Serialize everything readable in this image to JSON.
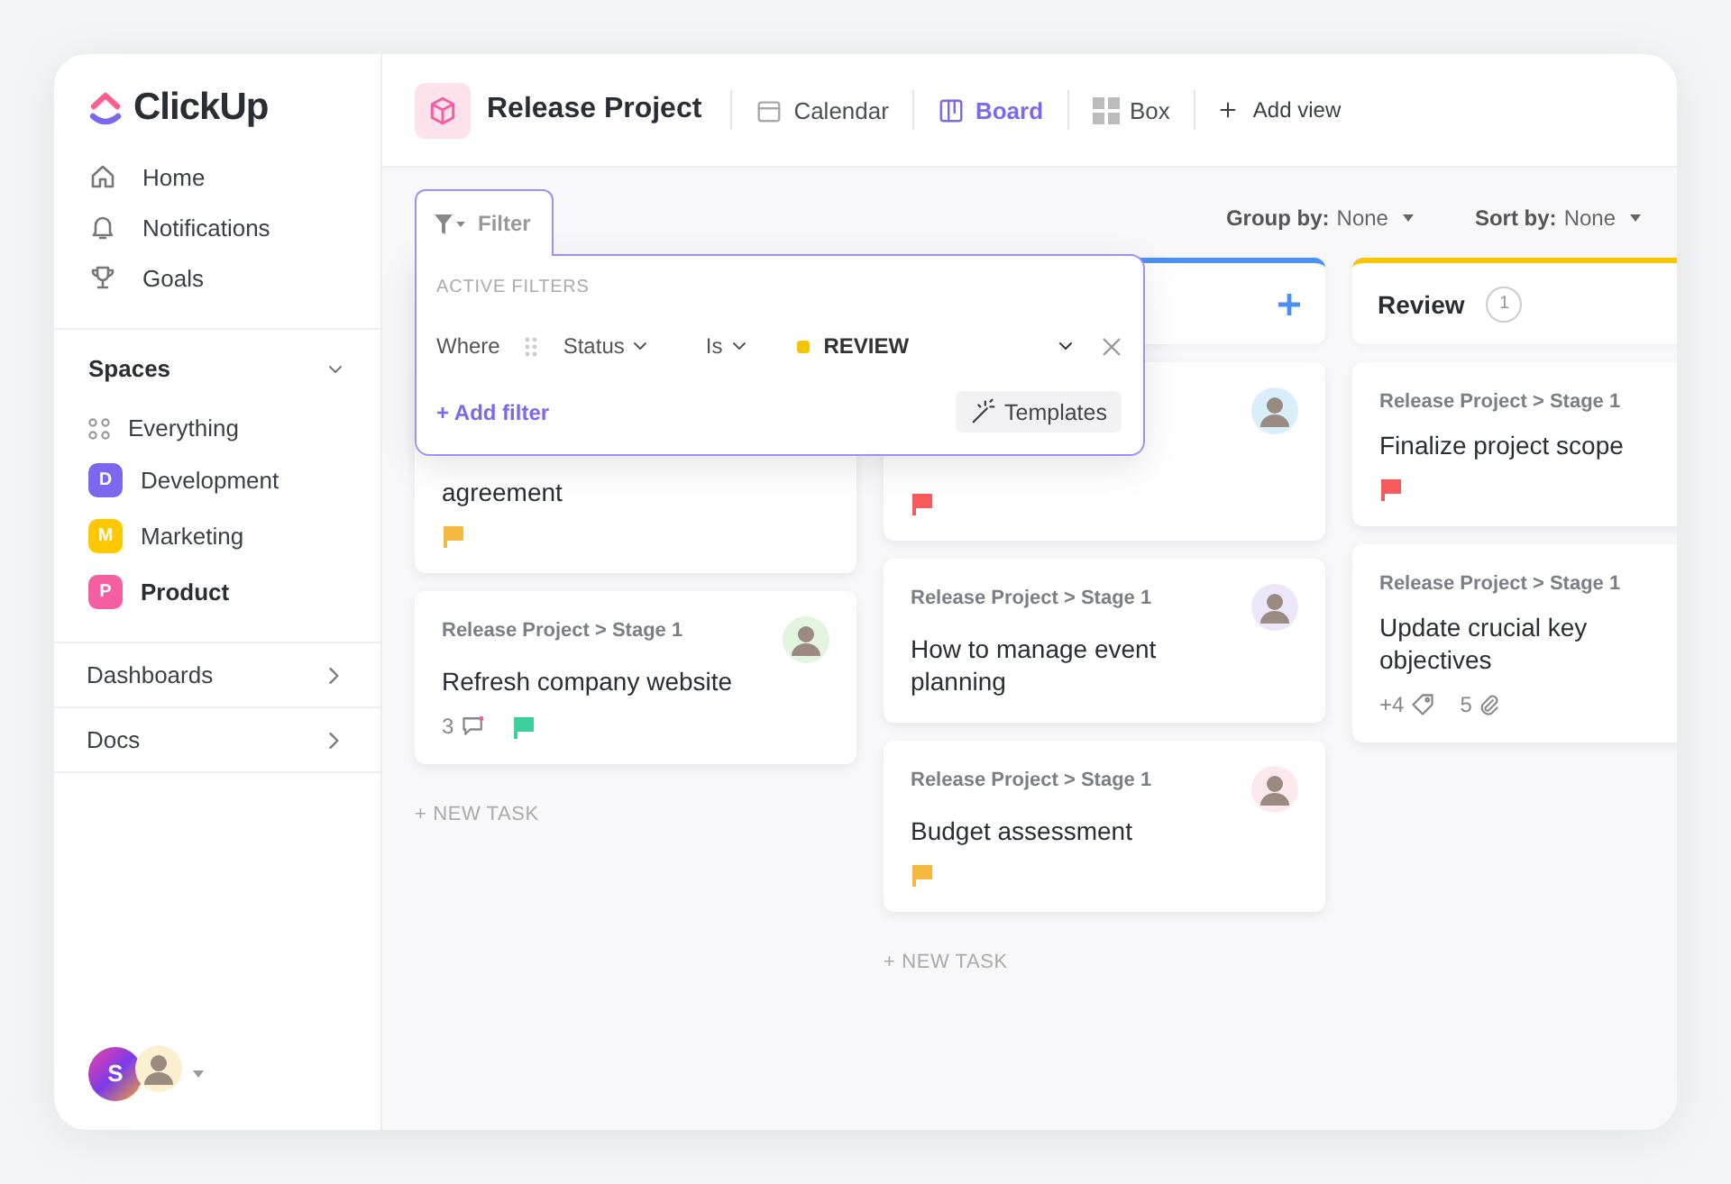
{
  "sidebar": {
    "logo": "ClickUp",
    "nav": [
      {
        "label": "Home",
        "kind": "home"
      },
      {
        "label": "Notifications",
        "kind": "bell"
      },
      {
        "label": "Goals",
        "kind": "trophy"
      }
    ],
    "spaces": {
      "title": "Spaces",
      "expanded": true,
      "items": [
        {
          "label": "Everything",
          "kind": "all",
          "selected": false
        },
        {
          "label": "Development",
          "kind": "space",
          "letter": "D",
          "color": "#7b68ee",
          "selected": false
        },
        {
          "label": "Marketing",
          "kind": "space",
          "letter": "M",
          "color": "#ffc800",
          "selected": false
        },
        {
          "label": "Product",
          "kind": "space",
          "letter": "P",
          "color": "#f55ea0",
          "selected": true
        }
      ]
    },
    "sections": [
      {
        "label": "Dashboards"
      },
      {
        "label": "Docs"
      }
    ],
    "user": {
      "initial": "S"
    }
  },
  "header": {
    "title": "Release Project",
    "views": [
      {
        "label": "Calendar",
        "kind": "calendar",
        "selected": false
      },
      {
        "label": "Board",
        "kind": "board",
        "selected": true
      },
      {
        "label": "Box",
        "kind": "box",
        "selected": false
      }
    ],
    "add_view": "Add view"
  },
  "toolbar": {
    "group_by": {
      "label": "Group by:",
      "value": "None"
    },
    "sort_by": {
      "label": "Sort by:",
      "value": "None"
    }
  },
  "filter": {
    "tab": "Filter",
    "heading": "ACTIVE FILTERS",
    "where": "Where",
    "field": "Status",
    "operator": "Is",
    "value": {
      "label": "REVIEW",
      "color": "#f5c400"
    },
    "add": "+ Add filter",
    "templates": "Templates"
  },
  "columns": [
    {
      "cards": [
        {
          "title": "agreement",
          "flag": {
            "color": "#f5b940"
          }
        },
        {
          "breadcrumb": "Release Project > Stage 1",
          "title": "Refresh company website",
          "avatar": true,
          "comments": "3",
          "flag": {
            "color": "#3ecf9e"
          }
        }
      ],
      "new_task": "+ NEW TASK"
    },
    {
      "color": "#4a90f5",
      "add": true,
      "cards": [
        {
          "avatar": true,
          "flag": {
            "color": "#f75a5a"
          }
        },
        {
          "breadcrumb": "Release Project > Stage 1",
          "title": "How to manage event planning",
          "avatar": true
        },
        {
          "breadcrumb": "Release Project > Stage 1",
          "title": "Budget assessment",
          "avatar": true,
          "flag": {
            "color": "#f5b940"
          }
        }
      ],
      "new_task": "+ NEW TASK"
    },
    {
      "color": "#f8c600",
      "title": "Review",
      "count": "1",
      "cards": [
        {
          "breadcrumb": "Release Project > Stage 1",
          "title": "Finalize project scope",
          "flag": {
            "color": "#f75a5a"
          }
        },
        {
          "breadcrumb": "Release Project > Stage 1",
          "title": "Update crucial key objectives",
          "tags": "+4",
          "attachments": "5"
        }
      ]
    }
  ]
}
